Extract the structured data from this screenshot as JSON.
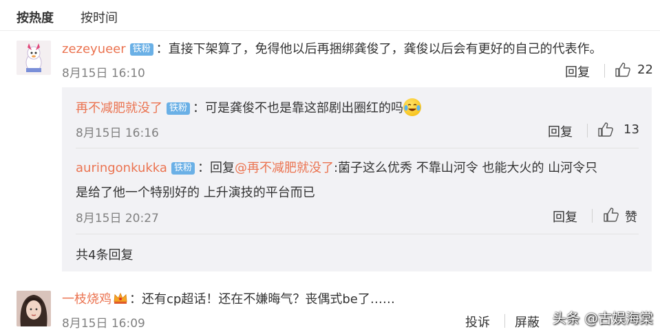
{
  "sort": {
    "hot": "按热度",
    "time": "按时间"
  },
  "comment1": {
    "user": "zezeyueer",
    "badge": "铁粉",
    "colon": "：",
    "text": "直接下架算了，免得他以后再捆绑龚俊了，龚俊以后会有更好的自己的代表作。",
    "time": "8月15日 16:10",
    "reply_label": "回复",
    "likes": "22"
  },
  "reply1": {
    "user": "再不减肥就没了",
    "badge": "铁粉",
    "colon": "：",
    "text": "可是龚俊不也是靠这部剧出圈红的吗",
    "emoji": "laugh-cry-emoji",
    "time": "8月15日 16:16",
    "reply_label": "回复",
    "likes": "13"
  },
  "reply2": {
    "user": "auringonkukka",
    "badge": "铁粉",
    "colon": "：",
    "prefix": "回复",
    "mention": "@再不减肥就没了",
    "text_line1": ":菌子这么优秀 不靠山河令 也能大火的 山河令只",
    "text_line2": "是给了他一个特别好的 上升演技的平台而已",
    "time": "8月15日 20:27",
    "reply_label": "回复",
    "like_label": "赞"
  },
  "more_replies": "共4条回复",
  "comment2": {
    "user": "一枝烧鸡",
    "colon": "：",
    "text": "还有cp超话！还在不嫌晦气？丧偶式be了……",
    "time": "8月15日 16:09",
    "report_label": "投诉",
    "block_label": "屏蔽"
  },
  "watermark": "头条 @古娱海棠",
  "colors": {
    "accent": "#eb7350",
    "badge": "#6ab0e6",
    "reply_bg": "#f2f2f5"
  }
}
